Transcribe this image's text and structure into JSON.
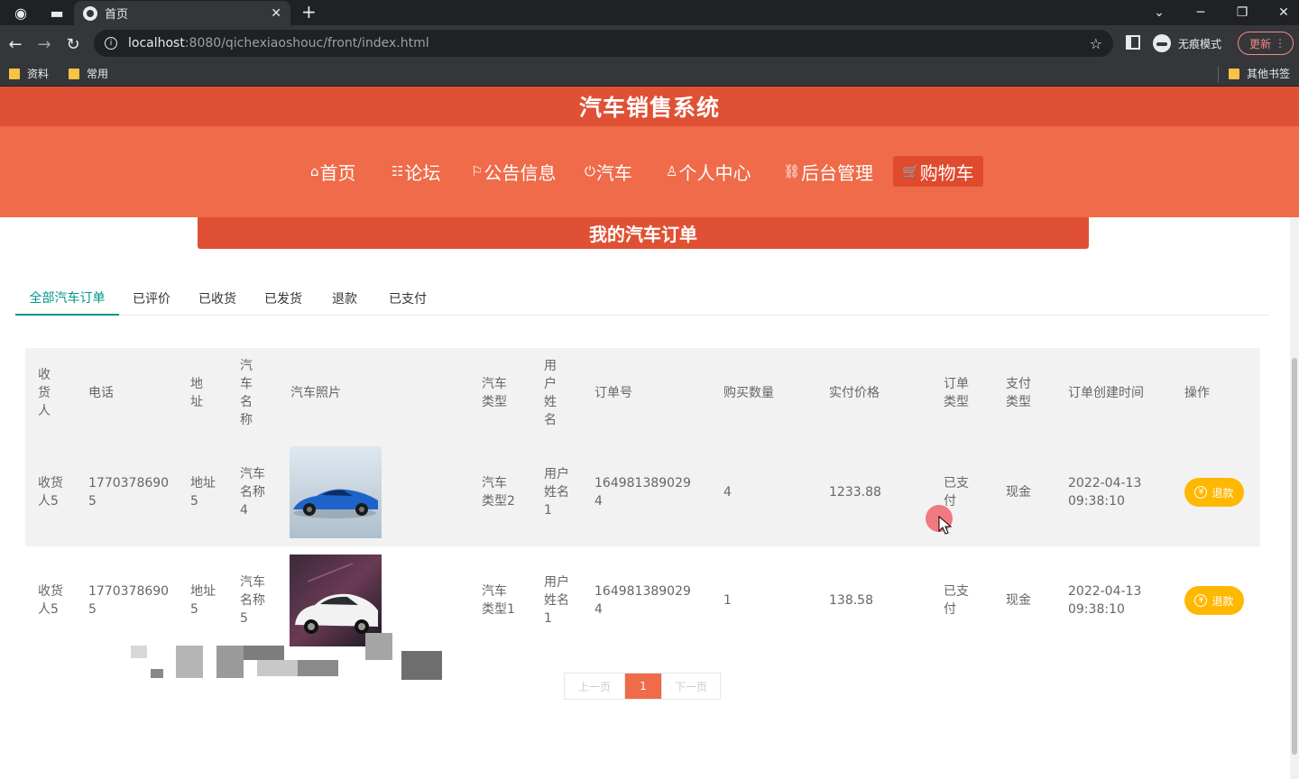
{
  "browser": {
    "tab_title": "首页",
    "new_tab": "+",
    "url_host": "localhost",
    "url_rest": ":8080/qichexiaoshouc/front/index.html",
    "incognito_label": "无痕模式",
    "update_label": "更新",
    "bookmarks": [
      "资料",
      "常用"
    ],
    "other_bookmarks": "其他书签"
  },
  "site": {
    "title": "汽车销售系统",
    "nav": [
      {
        "icon": "⌂",
        "label": "首页"
      },
      {
        "icon": "☷",
        "label": "论坛"
      },
      {
        "icon": "⚐",
        "label": "公告信息"
      },
      {
        "icon": "⏻",
        "label": "汽车"
      },
      {
        "icon": "♙",
        "label": "个人中心"
      },
      {
        "icon": "⛓",
        "label": "后台管理"
      },
      {
        "icon": "🛒",
        "label": "购物车"
      }
    ],
    "active_nav": "购物车",
    "accent_color": "#ef6b49",
    "header_color": "#e05034"
  },
  "orders": {
    "banner": "我的汽车订单",
    "tabs": [
      "全部汽车订单",
      "已评价",
      "已收货",
      "已发货",
      "退款",
      "已支付"
    ],
    "active_tab": "全部汽车订单",
    "columns": [
      "收货人",
      "电话",
      "地址",
      "汽车名称",
      "汽车照片",
      "汽车类型",
      "用户姓名",
      "订单号",
      "购买数量",
      "实付价格",
      "订单类型",
      "支付类型",
      "订单创建时间",
      "操作"
    ],
    "rows": [
      {
        "receiver": "收货人5",
        "phone": "17703786905",
        "address": "地址5",
        "car_name": "汽车名称4",
        "photo": "blue-sports-car",
        "car_type": "汽车类型2",
        "user_name": "用户姓名1",
        "order_no": "1649813890294",
        "quantity": "4",
        "price": "1233.88",
        "order_type": "已支付",
        "pay_type": "现金",
        "created": "2022-04-13 09:38:10",
        "action": "退款"
      },
      {
        "receiver": "收货人5",
        "phone": "17703786905",
        "address": "地址5",
        "car_name": "汽车名称5",
        "photo": "white-sedan",
        "car_type": "汽车类型1",
        "user_name": "用户姓名1",
        "order_no": "1649813890294",
        "quantity": "1",
        "price": "138.58",
        "order_type": "已支付",
        "pay_type": "现金",
        "created": "2022-04-13 09:38:10",
        "action": "退款"
      }
    ],
    "pagination": {
      "prev": "上一页",
      "current": "1",
      "next": "下一页"
    },
    "refund_color": "#ffb800",
    "tab_active_color": "#009688"
  }
}
